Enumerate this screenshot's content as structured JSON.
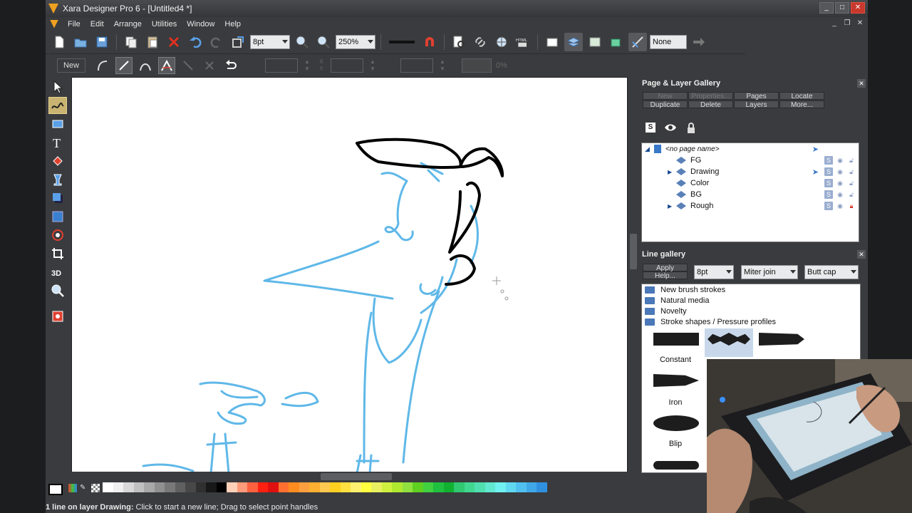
{
  "window": {
    "title": "Xara Designer Pro 6 - [Untitled4 *]"
  },
  "menu": [
    "File",
    "Edit",
    "Arrange",
    "Utilities",
    "Window",
    "Help"
  ],
  "toolbar": {
    "line_width": "8pt",
    "zoom": "250%",
    "html_label": "HTML",
    "none_label": "None"
  },
  "infobar": {
    "new_label": "New",
    "percent": "0%"
  },
  "page_gallery": {
    "title": "Page & Layer Gallery",
    "buttons_row1": [
      "New",
      "Properties...",
      "Pages",
      "Locate"
    ],
    "buttons_row2": [
      "Duplicate",
      "Delete",
      "Layers",
      "More..."
    ],
    "page_name": "<no page name>",
    "layers": [
      {
        "name": "FG",
        "expand": false,
        "locked": false,
        "pointer": false
      },
      {
        "name": "Drawing",
        "expand": true,
        "locked": false,
        "pointer": true
      },
      {
        "name": "Color",
        "expand": false,
        "locked": false,
        "pointer": false
      },
      {
        "name": "BG",
        "expand": false,
        "locked": false,
        "pointer": false
      },
      {
        "name": "Rough",
        "expand": true,
        "locked": true,
        "pointer": false
      }
    ]
  },
  "line_gallery": {
    "title": "Line gallery",
    "apply": "Apply",
    "help": "Help...",
    "width": "8pt",
    "join": "Miter join",
    "cap": "Butt cap",
    "folders": [
      "New brush strokes",
      "Natural media",
      "Novelty",
      "Stroke shapes / Pressure profiles"
    ],
    "shapes": [
      "Constant",
      "Iron",
      "Blip"
    ]
  },
  "status": {
    "bold": "1 line on layer Drawing:",
    "text": " Click to start a new line; Drag to select point handles"
  },
  "colors": {
    "palette": [
      "#ffffff",
      "#f0f0f0",
      "#d8d8d8",
      "#c0c0c0",
      "#a8a8a8",
      "#909090",
      "#787878",
      "#606060",
      "#484848",
      "#303030",
      "#181818",
      "#000000",
      "#ffd0b8",
      "#ff9a7a",
      "#ff6040",
      "#ff2010",
      "#e01010",
      "#ff7030",
      "#ff8c20",
      "#ffa040",
      "#ffb030",
      "#ffc850",
      "#ffd020",
      "#ffe040",
      "#fff070",
      "#ffff40",
      "#e8f060",
      "#d0f040",
      "#b0e830",
      "#90e040",
      "#60d020",
      "#40d040",
      "#20c040",
      "#10b030",
      "#30c870",
      "#40d890",
      "#50e0b0",
      "#60e8d0",
      "#70f0f0",
      "#60d8f0",
      "#50c0f0",
      "#40a8e8",
      "#3090e0"
    ],
    "sketch_blue": "#5fb8e8",
    "ink": "#000000"
  }
}
